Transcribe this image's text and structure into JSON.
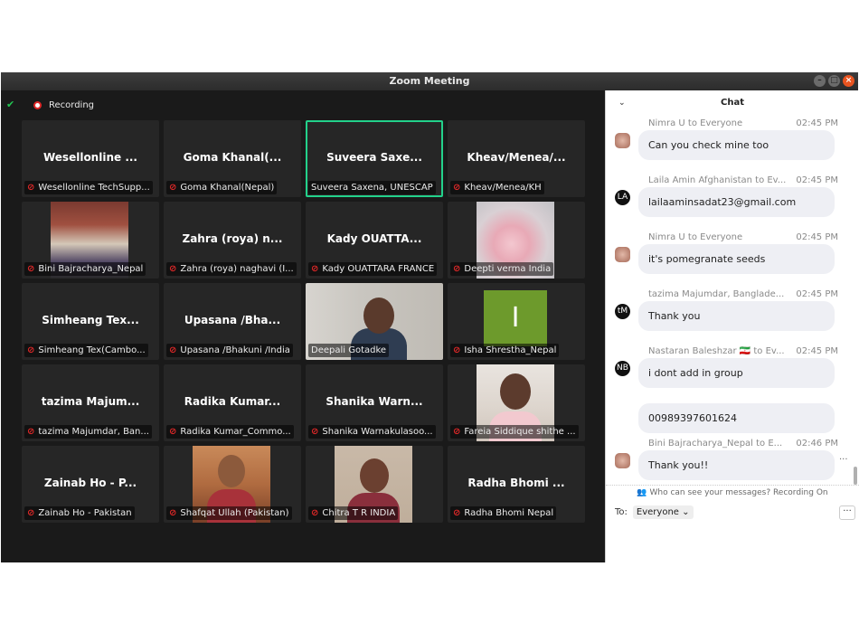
{
  "window": {
    "title": "Zoom Meeting"
  },
  "topbar": {
    "recording_label": "Recording",
    "shield_icon": "shield-check-icon"
  },
  "tiles": [
    {
      "title": "Wesellonline ...",
      "name": "Wesellonline TechSupp..."
    },
    {
      "title": "Goma Khanal(...",
      "name": "Goma Khanal(Nepal)"
    },
    {
      "title": "Suveera Saxe...",
      "name": "Suveera Saxena, UNESCAP",
      "active": true,
      "muted": false
    },
    {
      "title": "Kheav/Menea/...",
      "name": "Kheav/Menea/KH"
    },
    {
      "title": "",
      "name": "Bini Bajracharya_Nepal",
      "video": "family"
    },
    {
      "title": "Zahra (roya) n...",
      "name": "Zahra (roya) naghavi (I..."
    },
    {
      "title": "Kady OUATTA...",
      "name": "Kady OUATTARA FRANCE"
    },
    {
      "title": "",
      "name": "Deepti verma India",
      "video": "flower"
    },
    {
      "title": "Simheang Tex...",
      "name": "Simheang Tex(Cambo..."
    },
    {
      "title": "Upasana /Bha...",
      "name": "Upasana /Bhakuni /India"
    },
    {
      "title": "",
      "name": "Deepali Gotadke",
      "video": "webcam",
      "muted": false
    },
    {
      "title": "",
      "name": "Isha Shrestha_Nepal",
      "video": "avatar",
      "avatar_letter": "I"
    },
    {
      "title": "tazima Majum...",
      "name": "tazima Majumdar, Ban..."
    },
    {
      "title": "Radika Kumar...",
      "name": "Radika Kumar_Commo..."
    },
    {
      "title": "Shanika Warn...",
      "name": "Shanika Warnakulasoo..."
    },
    {
      "title": "",
      "name": "Fareia Siddique shithe ...",
      "video": "portrait"
    },
    {
      "title": "Zainab Ho - P...",
      "name": "Zainab Ho - Pakistan"
    },
    {
      "title": "",
      "name": "Shafqat Ullah (Pakistan)",
      "video": "man"
    },
    {
      "title": "",
      "name": "Chitra T R INDIA",
      "video": "woman"
    },
    {
      "title": "Radha Bhomi ...",
      "name": "Radha Bhomi Nepal"
    }
  ],
  "chat": {
    "header": "Chat",
    "messages": [
      {
        "sender": "Nimra U to Everyone",
        "time": "02:45 PM",
        "text": "Can you check mine too",
        "avatar": "photo"
      },
      {
        "sender": "Laila Amin Afghanistan to Ev...",
        "time": "02:45 PM",
        "text": "lailaaminsadat23@gmail.com",
        "avatar": "LA"
      },
      {
        "sender": "Nimra U to Everyone",
        "time": "02:45 PM",
        "text": "it's pomegranate seeds",
        "avatar": "photo"
      },
      {
        "sender": "tazima Majumdar, Banglade...",
        "time": "02:45 PM",
        "text": "Thank you",
        "avatar": "tM"
      },
      {
        "sender": "Nastaran Baleshzar 🇮🇷 to Ev...",
        "time": "02:45 PM",
        "text": "i dont add in group",
        "avatar": "NB"
      },
      {
        "sender": "",
        "time": "",
        "text": "00989397601624",
        "avatar": ""
      },
      {
        "sender": "Bini Bajracharya_Nepal to E...",
        "time": "02:46 PM",
        "text": "Thank you!!",
        "avatar": "photo"
      }
    ],
    "privacy_note": "Who can see your messages? Recording On",
    "to_label": "To:",
    "to_value": "Everyone"
  }
}
